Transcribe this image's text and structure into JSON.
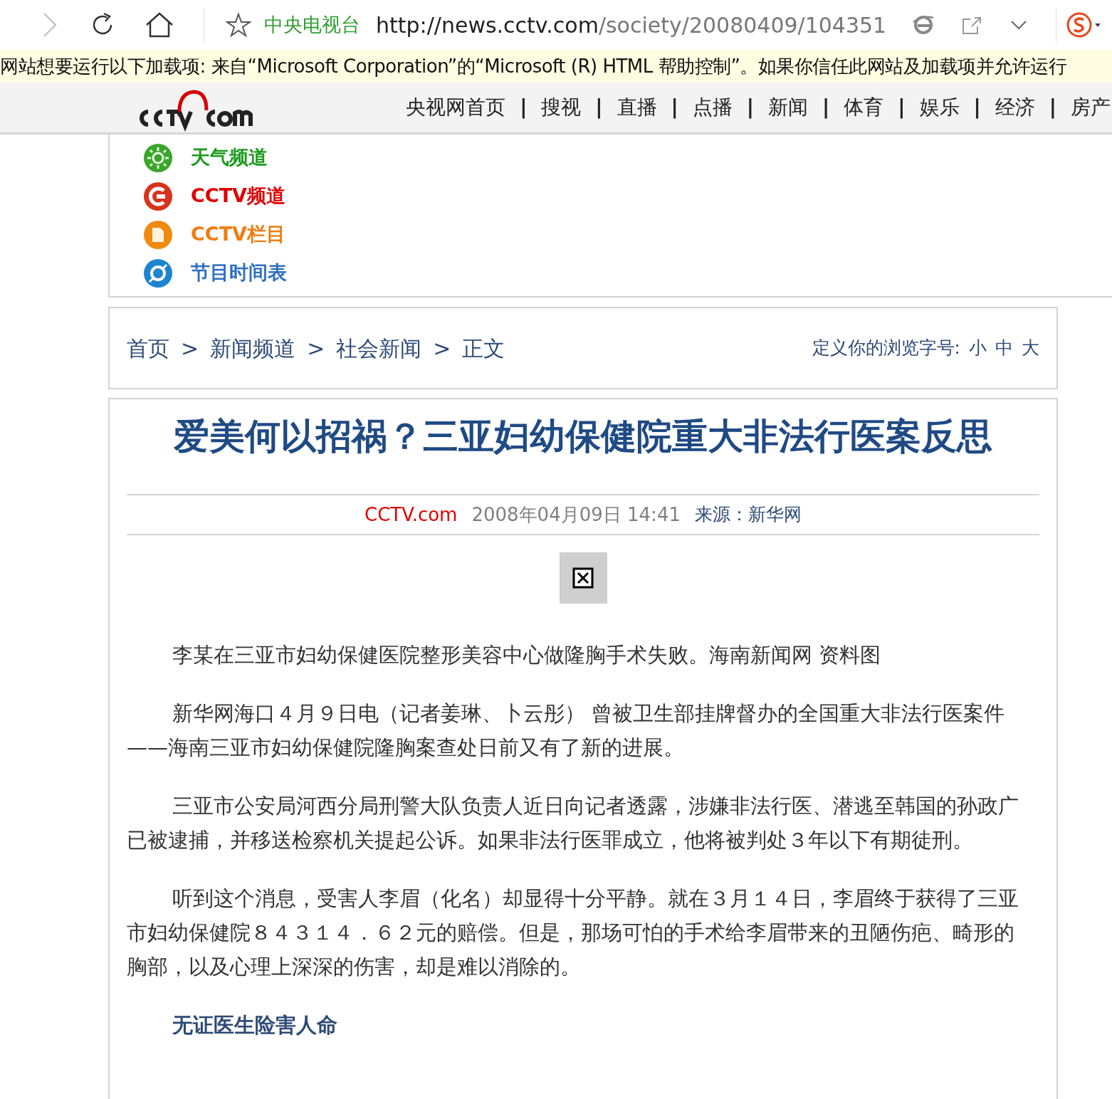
{
  "browser": {
    "site_name": "中央电视台",
    "url_host": "http://news.cctv.com",
    "url_path": "/society/20080409/104351"
  },
  "info_bar": {
    "text": "网站想要运行以下加载项: 来自“Microsoft Corporation”的“Microsoft (R) HTML 帮助控制”。如果你信任此网站及加载项并允许运行"
  },
  "header": {
    "nav": [
      {
        "kind": "link",
        "label": "央视网首页"
      },
      {
        "kind": "separator",
        "label": "|"
      },
      {
        "kind": "link",
        "label": "搜视"
      },
      {
        "kind": "separator",
        "label": "|"
      },
      {
        "kind": "link",
        "label": "直播"
      },
      {
        "kind": "separator",
        "label": "|"
      },
      {
        "kind": "link",
        "label": "点播"
      },
      {
        "kind": "separator",
        "label": "|"
      },
      {
        "kind": "link",
        "label": "新闻"
      },
      {
        "kind": "separator",
        "label": "|"
      },
      {
        "kind": "link",
        "label": "体育"
      },
      {
        "kind": "separator",
        "label": "|"
      },
      {
        "kind": "link",
        "label": "娱乐"
      },
      {
        "kind": "separator",
        "label": "|"
      },
      {
        "kind": "link",
        "label": "经济"
      },
      {
        "kind": "separator",
        "label": "|"
      },
      {
        "kind": "link",
        "label": "房产"
      }
    ]
  },
  "channels": [
    {
      "label": "天气频道",
      "color": "#1a9a1a",
      "kind": "weather"
    },
    {
      "label": "CCTV频道",
      "color": "#e00000",
      "kind": "channel"
    },
    {
      "label": "CCTV栏目",
      "color": "#f07d10",
      "kind": "column"
    },
    {
      "label": "节目时间表",
      "color": "#2f6fc0",
      "kind": "schedule"
    }
  ],
  "breadcrumb": {
    "items": [
      "首页",
      "新闻频道",
      "社会新闻",
      "正文"
    ],
    "separator": ">",
    "font_size_label": "定义你的浏览字号:",
    "font_sizes": [
      "小",
      "中",
      "大"
    ]
  },
  "article": {
    "title": "爱美何以招祸？三亚妇幼保健院重大非法行医案反思",
    "site": "CCTV.com",
    "date": "2008年04月09日 14:41",
    "source": "来源：新华网",
    "paragraphs": [
      {
        "kind": "caption",
        "text": "李某在三亚市妇幼保健医院整形美容中心做隆胸手术失败。海南新闻网 资料图"
      },
      {
        "kind": "body",
        "text": "新华网海口４月９日电（记者姜琳、卜云彤） 曾被卫生部挂牌督办的全国重大非法行医案件——海南三亚市妇幼保健院隆胸案查处日前又有了新的进展。"
      },
      {
        "kind": "body",
        "text": "三亚市公安局河西分局刑警大队负责人近日向记者透露，涉嫌非法行医、潜逃至韩国的孙政广已被逮捕，并移送检察机关提起公诉。如果非法行医罪成立，他将被判处３年以下有期徒刑。"
      },
      {
        "kind": "body",
        "text": "听到这个消息，受害人李眉（化名）却显得十分平静。就在３月１４日，李眉终于获得了三亚市妇幼保健院８４３１４．６２元的赔偿。但是，那场可怕的手术给李眉带来的丑陋伤疤、畸形的胸部，以及心理上深深的伤害，却是难以消除的。"
      },
      {
        "kind": "subheading",
        "text": "无证医生险害人命"
      }
    ]
  }
}
